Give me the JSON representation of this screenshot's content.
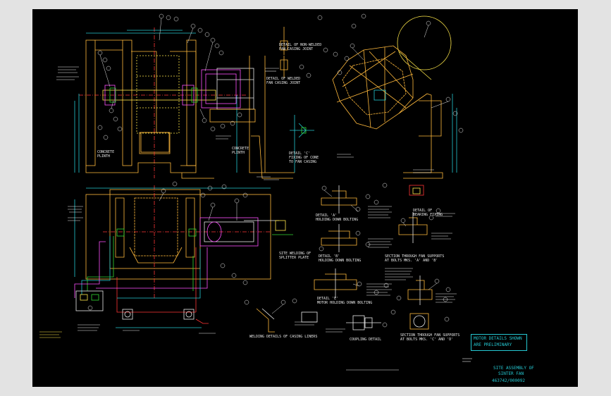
{
  "drawing": {
    "note_box": [
      "MOTOR DETAILS SHOWN",
      "ARE PRELIMINARY"
    ],
    "title": [
      "SITE ASSEMBLY OF",
      "SINTER FAN"
    ],
    "drawing_number": "463742/000092"
  },
  "labels": {
    "concrete_plinth_left": "CONCRETE\nPLINTH",
    "concrete_plinth_mid": "CONCRETE\nPLINTH",
    "detail_non_welded": "DETAIL OF NON-WELDED\nFAN CASING JOINT",
    "detail_welded": "DETAIL OF WELDED\nFAN CASING JOINT",
    "detail_cone": "DETAIL 'C'\nFIXING OF CONE\nTO FAN CASING",
    "detail_holding_down": "DETAIL 'A'\nHOLDING DOWN BOLTING",
    "detail_holding_down_b": "DETAIL 'B'\nHOLDING DOWN BOLTING",
    "detail_motor": "DETAIL 'E'\nMOTOR HOLDING DOWN BOLTING",
    "section_supports_1": "SECTION THROUGH FAN SUPPORTS\nAT BOLTS MKS. 'A' AND 'B'",
    "section_supports_2": "SECTION THROUGH FAN SUPPORTS\nAT BOLTS MKS. 'C' AND 'D'",
    "detail_bearing": "DETAIL OF\nBEARING FIXING",
    "site_welding": "SITE WELDING OF\nSPLITTER PLATE",
    "welding_details": "WELDING DETAILS OF CASING LINERS",
    "coupling_detail": "COUPLING DETAIL"
  }
}
